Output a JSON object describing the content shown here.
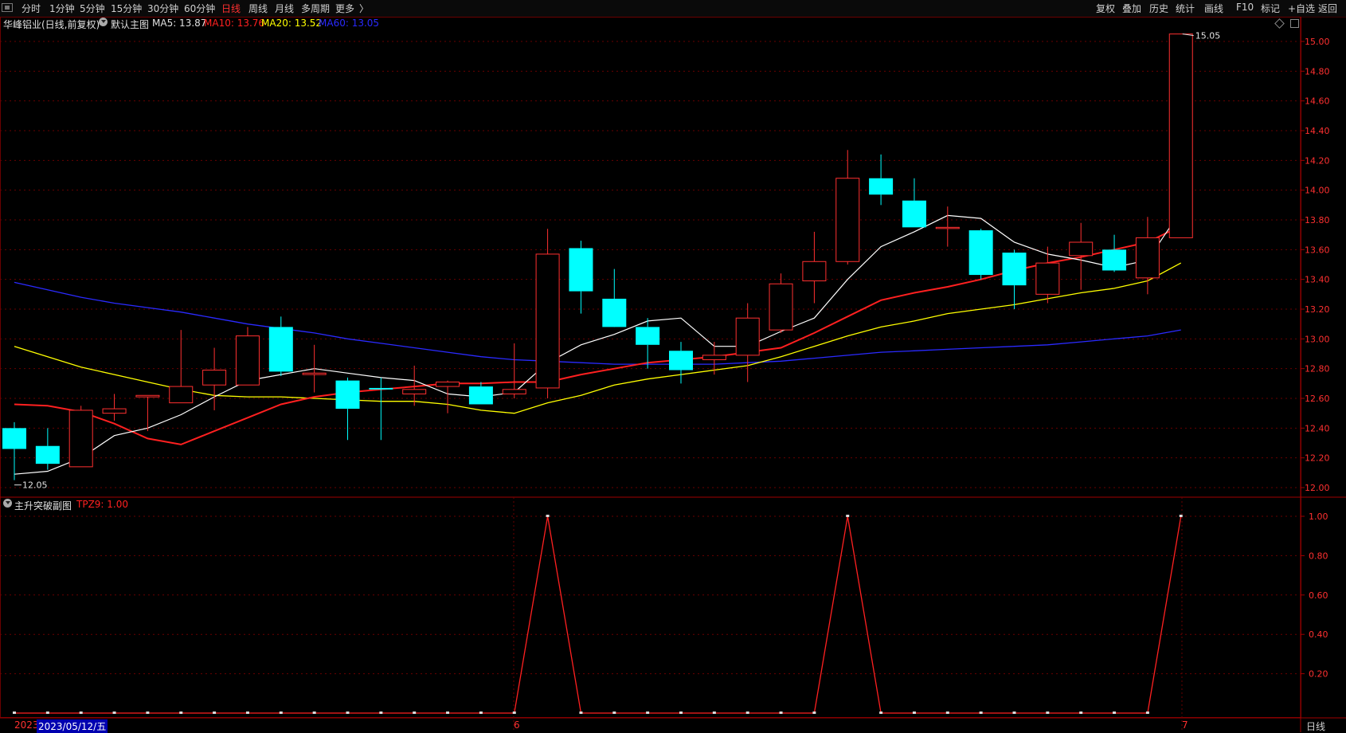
{
  "toolbar": {
    "periods": [
      {
        "label": "分时",
        "x": 27
      },
      {
        "label": "1分钟",
        "x": 62
      },
      {
        "label": "5分钟",
        "x": 100
      },
      {
        "label": "15分钟",
        "x": 139
      },
      {
        "label": "30分钟",
        "x": 185
      },
      {
        "label": "60分钟",
        "x": 231
      },
      {
        "label": "日线",
        "x": 278,
        "active": true
      },
      {
        "label": "周线",
        "x": 312
      },
      {
        "label": "月线",
        "x": 345
      },
      {
        "label": "多周期",
        "x": 378
      },
      {
        "label": "更多",
        "x": 421
      }
    ],
    "more_arrow": "〉",
    "right_buttons": [
      "复权",
      "叠加",
      "历史",
      "统计",
      "画线",
      "F10",
      "标记",
      "+自选",
      "返回"
    ]
  },
  "main_chart": {
    "stock_title": "华峰铝业(日线,前复权)",
    "panel_name": "默认主图",
    "ma5_label": "MA5: 13.87",
    "ma10_label": "MA10: 13.76",
    "ma20_label": "MA20: 13.52",
    "ma60_label": "MA60: 13.05",
    "high_marker": "15.05",
    "low_marker": "12.05"
  },
  "sub_chart": {
    "panel_name": "主升突破副图",
    "indicator_label": "TPZ9: 1.00"
  },
  "date_bar": {
    "start_label": "2023",
    "cursor_date": "2023/05/12/五",
    "month_6": "6",
    "month_7": "7",
    "period": "日线"
  },
  "colors": {
    "up": "#ff3030",
    "down": "#00ffff",
    "ma5": "#ffffff",
    "ma10": "#ff2020",
    "ma20": "#ffff00",
    "ma60": "#2a2aff",
    "grid": "#6a0000",
    "tpz9": "#ff2020"
  },
  "chart_data": {
    "type": "candlestick",
    "y_range": [
      12.0,
      15.1
    ],
    "y_ticks": [
      "15.00",
      "14.80",
      "14.60",
      "14.40",
      "14.20",
      "14.00",
      "13.80",
      "13.60",
      "13.40",
      "13.20",
      "13.00",
      "12.80",
      "12.60",
      "12.40",
      "12.20",
      "12.00"
    ],
    "candles": [
      {
        "o": 12.4,
        "h": 12.44,
        "l": 12.05,
        "c": 12.26
      },
      {
        "o": 12.28,
        "h": 12.4,
        "l": 12.12,
        "c": 12.16
      },
      {
        "o": 12.14,
        "h": 12.55,
        "l": 12.14,
        "c": 12.52
      },
      {
        "o": 12.5,
        "h": 12.63,
        "l": 12.45,
        "c": 12.53
      },
      {
        "o": 12.61,
        "h": 12.62,
        "l": 12.38,
        "c": 12.62
      },
      {
        "o": 12.57,
        "h": 13.06,
        "l": 12.57,
        "c": 12.68
      },
      {
        "o": 12.69,
        "h": 12.94,
        "l": 12.52,
        "c": 12.79
      },
      {
        "o": 12.69,
        "h": 13.08,
        "l": 12.69,
        "c": 13.02
      },
      {
        "o": 13.08,
        "h": 13.15,
        "l": 12.75,
        "c": 12.78
      },
      {
        "o": 12.76,
        "h": 12.96,
        "l": 12.64,
        "c": 12.77
      },
      {
        "o": 12.72,
        "h": 12.74,
        "l": 12.32,
        "c": 12.53
      },
      {
        "o": 12.67,
        "h": 12.74,
        "l": 12.32,
        "c": 12.66
      },
      {
        "o": 12.63,
        "h": 12.82,
        "l": 12.55,
        "c": 12.66
      },
      {
        "o": 12.68,
        "h": 12.72,
        "l": 12.5,
        "c": 12.71
      },
      {
        "o": 12.68,
        "h": 12.71,
        "l": 12.56,
        "c": 12.56
      },
      {
        "o": 12.63,
        "h": 12.97,
        "l": 12.6,
        "c": 12.66
      },
      {
        "o": 12.67,
        "h": 13.74,
        "l": 12.6,
        "c": 13.57
      },
      {
        "o": 13.61,
        "h": 13.66,
        "l": 13.17,
        "c": 13.32
      },
      {
        "o": 13.27,
        "h": 13.47,
        "l": 13.1,
        "c": 13.08
      },
      {
        "o": 13.08,
        "h": 13.14,
        "l": 12.8,
        "c": 12.96
      },
      {
        "o": 12.92,
        "h": 12.98,
        "l": 12.7,
        "c": 12.79
      },
      {
        "o": 12.86,
        "h": 12.98,
        "l": 12.76,
        "c": 12.89
      },
      {
        "o": 12.89,
        "h": 13.24,
        "l": 12.71,
        "c": 13.14
      },
      {
        "o": 13.06,
        "h": 13.44,
        "l": 13.04,
        "c": 13.37
      },
      {
        "o": 13.39,
        "h": 13.72,
        "l": 13.24,
        "c": 13.52
      },
      {
        "o": 13.52,
        "h": 14.27,
        "l": 13.5,
        "c": 14.08
      },
      {
        "o": 14.08,
        "h": 14.24,
        "l": 13.9,
        "c": 13.97
      },
      {
        "o": 13.93,
        "h": 14.08,
        "l": 13.75,
        "c": 13.75
      },
      {
        "o": 13.75,
        "h": 13.89,
        "l": 13.62,
        "c": 13.75
      },
      {
        "o": 13.73,
        "h": 13.74,
        "l": 13.4,
        "c": 13.43
      },
      {
        "o": 13.58,
        "h": 13.6,
        "l": 13.2,
        "c": 13.36
      },
      {
        "o": 13.3,
        "h": 13.62,
        "l": 13.24,
        "c": 13.51
      },
      {
        "o": 13.56,
        "h": 13.78,
        "l": 13.33,
        "c": 13.65
      },
      {
        "o": 13.6,
        "h": 13.7,
        "l": 13.45,
        "c": 13.46
      },
      {
        "o": 13.41,
        "h": 13.82,
        "l": 13.3,
        "c": 13.68
      },
      {
        "o": 13.68,
        "h": 15.05,
        "l": 13.68,
        "c": 15.05
      }
    ],
    "ma5": [
      12.09,
      12.11,
      12.2,
      12.35,
      12.4,
      12.49,
      12.61,
      12.72,
      12.76,
      12.8,
      12.77,
      12.74,
      12.72,
      12.63,
      12.61,
      12.64,
      12.84,
      12.96,
      13.03,
      13.12,
      13.14,
      12.95,
      12.95,
      13.05,
      13.14,
      13.4,
      13.62,
      13.72,
      13.83,
      13.81,
      13.65,
      13.57,
      13.53,
      13.48,
      13.53,
      13.86
    ],
    "ma10": [
      12.56,
      12.55,
      12.51,
      12.43,
      12.33,
      12.29,
      12.38,
      12.47,
      12.56,
      12.61,
      12.64,
      12.66,
      12.68,
      12.7,
      12.7,
      12.71,
      12.71,
      12.76,
      12.8,
      12.84,
      12.86,
      12.88,
      12.91,
      12.94,
      13.04,
      13.15,
      13.26,
      13.31,
      13.35,
      13.4,
      13.46,
      13.51,
      13.55,
      13.6,
      13.65,
      13.76
    ],
    "ma20": [
      12.95,
      12.88,
      12.81,
      12.76,
      12.71,
      12.66,
      12.62,
      12.61,
      12.61,
      12.6,
      12.59,
      12.58,
      12.58,
      12.56,
      12.52,
      12.5,
      12.57,
      12.62,
      12.69,
      12.73,
      12.76,
      12.79,
      12.82,
      12.88,
      12.95,
      13.02,
      13.08,
      13.12,
      13.17,
      13.2,
      13.23,
      13.27,
      13.31,
      13.34,
      13.39,
      13.51
    ],
    "ma60": [
      13.38,
      13.33,
      13.28,
      13.24,
      13.21,
      13.18,
      13.14,
      13.1,
      13.07,
      13.04,
      13.0,
      12.97,
      12.94,
      12.91,
      12.88,
      12.86,
      12.85,
      12.84,
      12.83,
      12.83,
      12.83,
      12.83,
      12.84,
      12.85,
      12.87,
      12.89,
      12.91,
      12.92,
      12.93,
      12.94,
      12.95,
      12.96,
      12.98,
      13.0,
      13.02,
      13.06
    ],
    "tpz9": [
      0,
      0,
      0,
      0,
      0,
      0,
      0,
      0,
      0,
      0,
      0,
      0,
      0,
      0,
      0,
      0,
      1,
      0,
      0,
      0,
      0,
      0,
      0,
      0,
      0,
      1,
      0,
      0,
      0,
      0,
      0,
      0,
      0,
      0,
      0,
      1
    ],
    "tpz9_y_range": [
      0,
      1.05
    ],
    "tpz9_ticks": [
      "1.00",
      "0.80",
      "0.60",
      "0.40",
      "0.20"
    ]
  }
}
